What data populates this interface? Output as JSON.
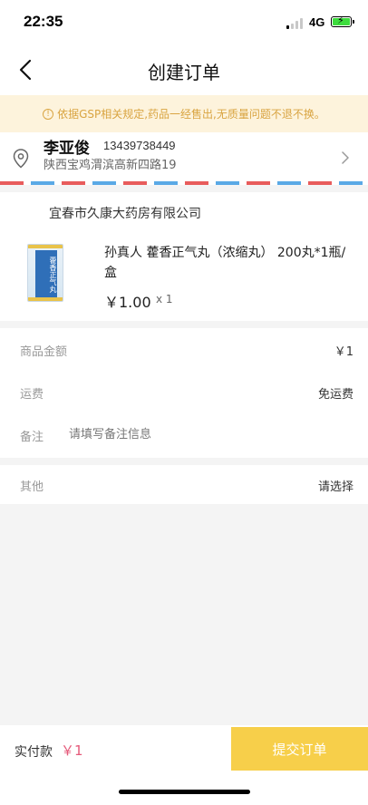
{
  "status_bar": {
    "time": "22:35",
    "network": "4G",
    "battery_icon": "battery-charging-icon"
  },
  "nav": {
    "title": "创建订单",
    "back_icon": "chevron-left-icon"
  },
  "notice": {
    "icon": "info-icon",
    "text": "依据GSP相关规定,药品一经售出,无质量问题不退不换。",
    "color": "#d9a441",
    "background": "#fdf3dc"
  },
  "address": {
    "name": "李亚俊",
    "phone": "13439738449",
    "detail": "陕西宝鸡渭滨高新四路19",
    "icon": "location-pin-icon"
  },
  "store": {
    "name": "宜春市久康大药房有限公司",
    "product": {
      "title": "孙真人 藿香正气丸（浓缩丸） 200丸*1瓶/盒",
      "image_text": "藿香正气丸",
      "price": "￥1.00",
      "quantity": "x 1"
    }
  },
  "summary": {
    "goods_amount_label": "商品金额",
    "goods_amount_value": "￥1",
    "shipping_label": "运费",
    "shipping_value": "免运费",
    "remark_label": "备注",
    "remark_placeholder": "请填写备注信息",
    "other_label": "其他",
    "other_value": "请选择"
  },
  "bottom": {
    "pay_label": "实付款",
    "pay_amount": "￥1",
    "submit_label": "提交订单",
    "accent_color": "#f7cf4a",
    "price_color": "#e55a7a"
  }
}
